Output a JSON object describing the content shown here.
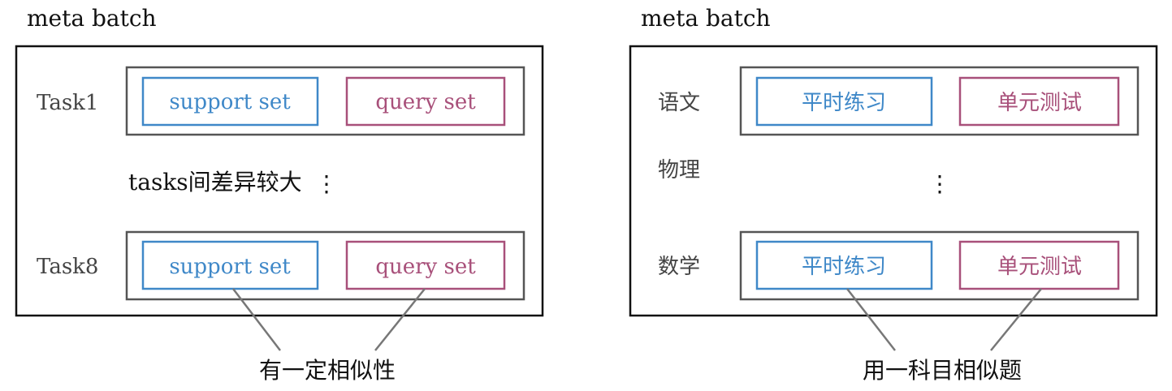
{
  "colors": {
    "support": "#3f88c8",
    "query": "#a8507a",
    "inner": "#555555",
    "outer": "#111111"
  },
  "left": {
    "title": "meta batch",
    "task_top": {
      "label": "Task1",
      "support": "support set",
      "query": "query set"
    },
    "middle_text": "tasks间差异较大",
    "ellipsis": "⋮",
    "task_bottom": {
      "label": "Task8",
      "support": "support set",
      "query": "query set"
    },
    "caption": "有一定相似性"
  },
  "right": {
    "title": "meta batch",
    "task_top": {
      "label": "语文",
      "support": "平时练习",
      "query": "单元测试"
    },
    "middle_label": "物理",
    "ellipsis": "⋮",
    "task_bottom": {
      "label": "数学",
      "support": "平时练习",
      "query": "单元测试"
    },
    "caption": "用一科目相似题"
  }
}
